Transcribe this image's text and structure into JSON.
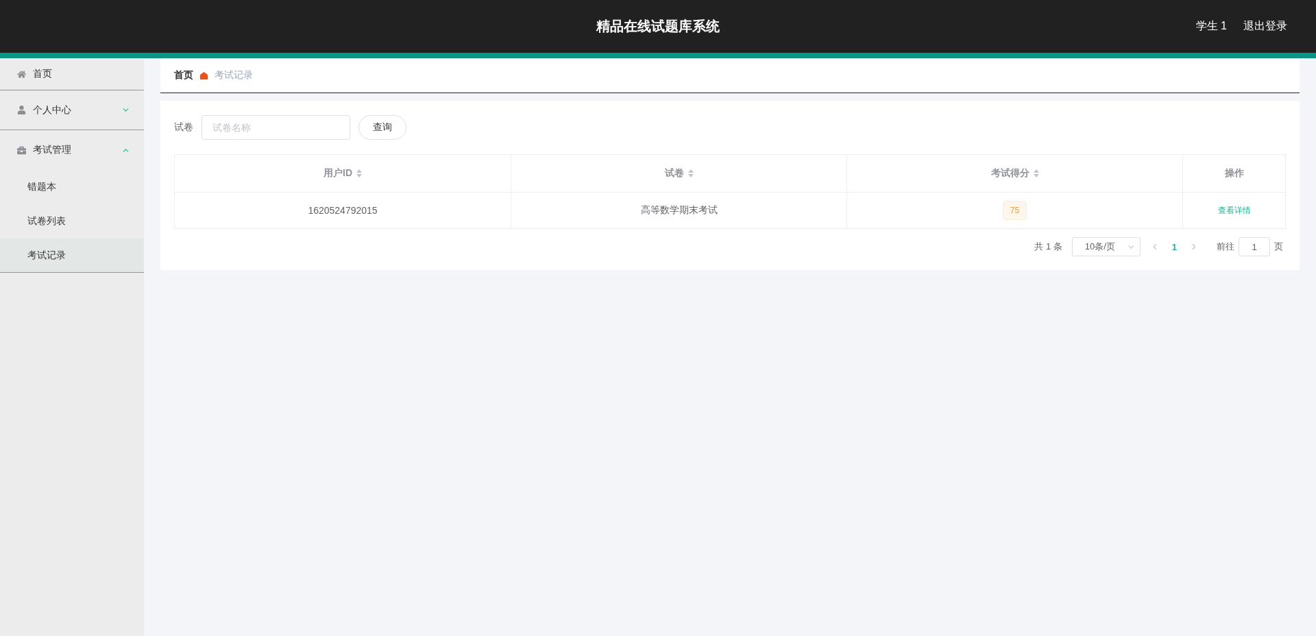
{
  "header": {
    "title": "精品在线试题库系统",
    "user": "学生 1",
    "logout": "退出登录"
  },
  "sidebar": {
    "items": [
      {
        "label": "首页"
      },
      {
        "label": "个人中心",
        "expanded": false
      },
      {
        "label": "考试管理",
        "expanded": true,
        "children": [
          {
            "label": "错题本",
            "selected": false
          },
          {
            "label": "试卷列表",
            "selected": false
          },
          {
            "label": "考试记录",
            "selected": true
          }
        ]
      }
    ]
  },
  "breadcrumb": {
    "items": [
      "首页",
      "考试记录"
    ]
  },
  "search": {
    "label": "试卷",
    "placeholder": "试卷名称",
    "button": "查询"
  },
  "table": {
    "columns": [
      {
        "label": "用户ID",
        "sortable": true
      },
      {
        "label": "试卷",
        "sortable": true
      },
      {
        "label": "考试得分",
        "sortable": true
      },
      {
        "label": "操作",
        "sortable": false
      }
    ],
    "rows": [
      {
        "user_id": "1620524792015",
        "paper": "高等数学期末考试",
        "score": "75",
        "action": "查看详情"
      }
    ]
  },
  "pagination": {
    "total": "共 1 条",
    "page_size": "10条/页",
    "pages": [
      {
        "label": "1",
        "selected": true
      }
    ],
    "goto_label": "前往",
    "goto_value": "1",
    "goto_suffix": "页"
  }
}
